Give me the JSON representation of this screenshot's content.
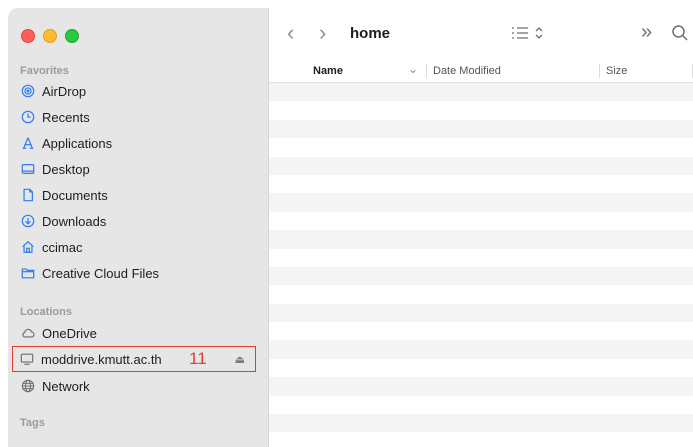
{
  "window": {
    "title": "home"
  },
  "sidebar": {
    "favorites_title": "Favorites",
    "favorites": [
      {
        "label": "AirDrop",
        "icon": "airdrop-icon"
      },
      {
        "label": "Recents",
        "icon": "clock-icon"
      },
      {
        "label": "Applications",
        "icon": "applications-icon"
      },
      {
        "label": "Desktop",
        "icon": "desktop-icon"
      },
      {
        "label": "Documents",
        "icon": "document-icon"
      },
      {
        "label": "Downloads",
        "icon": "download-icon"
      },
      {
        "label": "ccimac",
        "icon": "home-icon"
      },
      {
        "label": "Creative Cloud Files",
        "icon": "folder-icon"
      }
    ],
    "locations_title": "Locations",
    "locations": [
      {
        "label": "OneDrive",
        "icon": "cloud-icon"
      },
      {
        "label": "moddrive.kmutt.ac.th",
        "icon": "server-icon",
        "annotation": "11",
        "eject": "⏏"
      },
      {
        "label": "Network",
        "icon": "network-icon"
      }
    ],
    "tags_title": "Tags"
  },
  "toolbar": {
    "back": "‹",
    "forward": "›",
    "title": "home",
    "view_icon": "list-view-icon",
    "more": "»",
    "search_icon": "search-icon"
  },
  "columns": {
    "name": "Name",
    "date": "Date Modified",
    "size": "Size"
  },
  "colors": {
    "highlight": "#e53b2f",
    "accent": "#2f7cf6"
  }
}
